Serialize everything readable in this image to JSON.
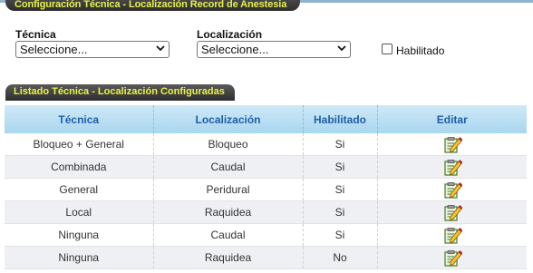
{
  "config": {
    "title": "Configuración Técnica - Localización Record de Anestesia",
    "tecnica_label": "Técnica",
    "tecnica_value": "Seleccione...",
    "localizacion_label": "Localización",
    "localizacion_value": "Seleccione...",
    "habilitado_label": "Habilitado",
    "habilitado_checked": false
  },
  "list": {
    "title": "Listado Técnica - Localización Configuradas",
    "headers": [
      "Técnica",
      "Localización",
      "Habilitado",
      "Editar"
    ],
    "rows": [
      {
        "tecnica": "Bloqueo + General",
        "localizacion": "Bloqueo",
        "habilitado": "Si",
        "icon": "edit-icon"
      },
      {
        "tecnica": "Combinada",
        "localizacion": "Caudal",
        "habilitado": "Si",
        "icon": "edit-icon"
      },
      {
        "tecnica": "General",
        "localizacion": "Peridural",
        "habilitado": "Si",
        "icon": "edit-icon"
      },
      {
        "tecnica": "Local",
        "localizacion": "Raquidea",
        "habilitado": "Si",
        "icon": "edit-icon"
      },
      {
        "tecnica": "Ninguna",
        "localizacion": "Caudal",
        "habilitado": "Si",
        "icon": "edit-icon"
      },
      {
        "tecnica": "Ninguna",
        "localizacion": "Raquidea",
        "habilitado": "No",
        "icon": "edit-icon"
      }
    ]
  },
  "colors": {
    "tab_text": "#e8f04a",
    "header_text": "#1f5fa6",
    "header_bg": "#b8def2"
  }
}
